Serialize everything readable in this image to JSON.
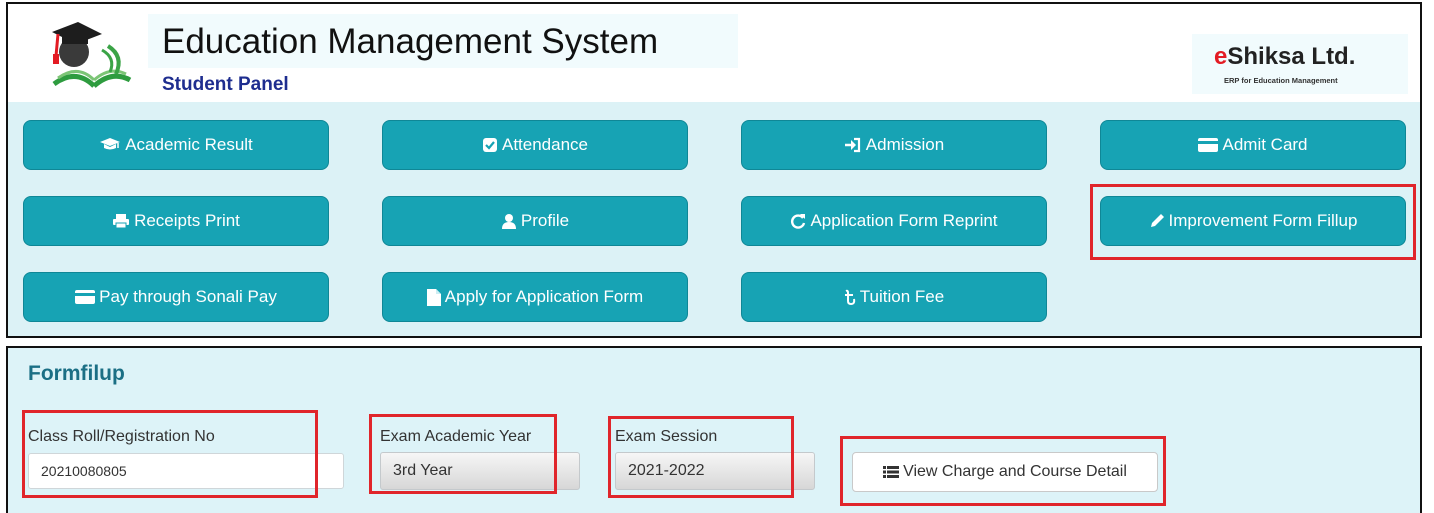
{
  "header": {
    "title": "Education Management System",
    "subtitle": "Student Panel",
    "brand_e": "e",
    "brand_rest": "Shiksa Ltd.",
    "brand_tagline": "ERP for Education Management"
  },
  "nav": [
    {
      "label": "Academic Result",
      "icon": "graduation-cap-icon"
    },
    {
      "label": "Attendance",
      "icon": "check-square-icon"
    },
    {
      "label": "Admission",
      "icon": "sign-in-icon"
    },
    {
      "label": "Admit Card",
      "icon": "credit-card-icon"
    },
    {
      "label": "Receipts Print",
      "icon": "print-icon"
    },
    {
      "label": "Profile",
      "icon": "user-icon"
    },
    {
      "label": "Application Form Reprint",
      "icon": "refresh-icon"
    },
    {
      "label": "Improvement Form Fillup",
      "icon": "pencil-icon"
    },
    {
      "label": "Pay through Sonali Pay",
      "icon": "credit-card-icon"
    },
    {
      "label": "Apply for Application Form",
      "icon": "file-icon"
    },
    {
      "label": "Tuition Fee",
      "icon": "taka-icon"
    }
  ],
  "colors": {
    "accent": "#17a3b4",
    "highlight": "#e0252b",
    "panel": "#dcf2f6",
    "section_title": "#1b6f85"
  },
  "form": {
    "section_title": "Formfilup",
    "roll_label": "Class Roll/Registration No",
    "roll_value": "20210080805",
    "year_label": "Exam Academic Year",
    "year_value": "3rd Year",
    "session_label": "Exam Session",
    "session_value": "2021-2022",
    "view_button": "View Charge and Course Detail"
  }
}
